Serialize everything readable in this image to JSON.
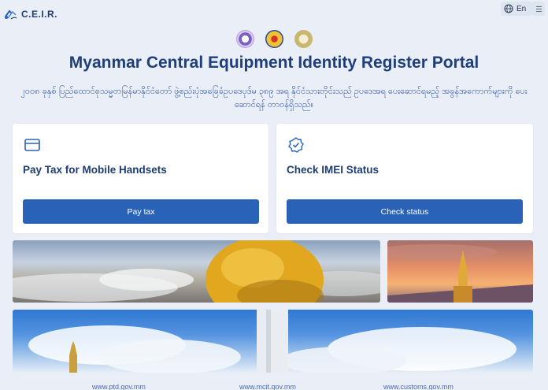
{
  "header": {
    "logo_text": "C.E.I.R.",
    "language": "En",
    "icons": [
      "globe-icon",
      "menu-icon"
    ]
  },
  "emblems": [
    "ministry-emblem",
    "regulator-emblem",
    "customs-emblem"
  ],
  "title": "Myanmar Central Equipment Identity Register Portal",
  "subtitle": "၂၀၀၈ ခုနှစ် ပြည်ထောင်စုသမ္မတမြန်မာနိုင်ငံတော် ဖွဲ့စည်းပုံအခြေခံဥပဒေပုဒ်မ ၃၈၉ အရ နိုင်ငံသားတိုင်းသည် ဥပဒေအရ ပေးဆောင်ရမည့် အခွန်အကောက်များကို ပေးဆောင်ရန် တာဝန်ရှိသည်။",
  "cards": [
    {
      "title": "Pay Tax for Mobile Handsets",
      "button": "Pay tax",
      "icon": "credit-card-icon"
    },
    {
      "title": "Check IMEI Status",
      "button": "Check status",
      "icon": "verified-badge-icon"
    }
  ],
  "footer_links": [
    "www.ptd.gov.mm",
    "www.mcit.gov.mm",
    "www.customs.gov.mm"
  ],
  "colors": {
    "primary": "#2a62b7",
    "title": "#1f3f7c",
    "background": "#e9eef7"
  }
}
